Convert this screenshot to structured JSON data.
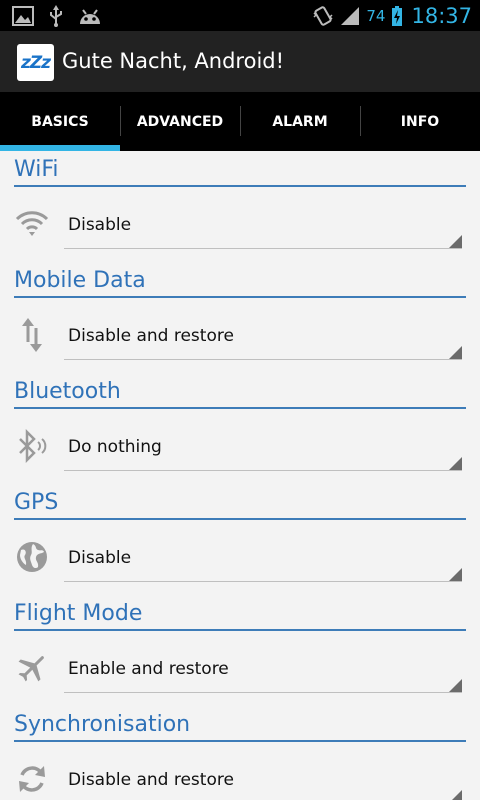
{
  "status_bar": {
    "battery_level": "74",
    "clock": "18:37",
    "colors": {
      "accent": "#33b5e5"
    }
  },
  "action_bar": {
    "app_icon_text": "zZz",
    "title": "Gute Nacht, Android!"
  },
  "tabs": [
    {
      "label": "BASICS",
      "active": true
    },
    {
      "label": "ADVANCED",
      "active": false
    },
    {
      "label": "ALARM",
      "active": false
    },
    {
      "label": "INFO",
      "active": false
    }
  ],
  "sections": [
    {
      "title": "WiFi",
      "icon": "wifi-icon",
      "value": "Disable"
    },
    {
      "title": "Mobile Data",
      "icon": "mobile-data-icon",
      "value": "Disable and restore"
    },
    {
      "title": "Bluetooth",
      "icon": "bluetooth-icon",
      "value": "Do nothing"
    },
    {
      "title": "GPS",
      "icon": "globe-icon",
      "value": "Disable"
    },
    {
      "title": "Flight Mode",
      "icon": "airplane-icon",
      "value": "Enable and restore"
    },
    {
      "title": "Synchronisation",
      "icon": "sync-icon",
      "value": "Disable and restore"
    }
  ],
  "colors": {
    "section_title": "#2f72b8",
    "tab_indicator": "#33b5e5",
    "background": "#f3f3f3"
  }
}
